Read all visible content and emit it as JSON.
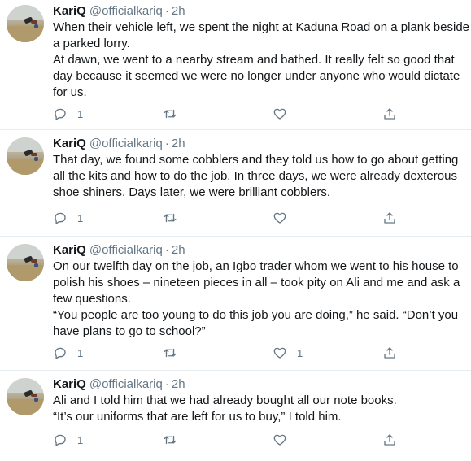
{
  "tweets": [
    {
      "name": "KariQ",
      "handle": "@officialkariq",
      "separator": "·",
      "time": "2h",
      "paragraphs": [
        "When their vehicle left, we spent the night at Kaduna Road on a plank beside a parked lorry.",
        "At dawn, we went to a nearby stream and bathed. It really felt so good that day because it seemed we were no longer under anyone who would dictate for us."
      ],
      "reply_count": "1",
      "retweet_count": "",
      "like_count": ""
    },
    {
      "name": "KariQ",
      "handle": "@officialkariq",
      "separator": "·",
      "time": "2h",
      "paragraphs": [
        "That day, we found some cobblers and they told us how to go about getting all the kits and how to do the job. In three days, we were already dexterous shoe shiners. Days later, we were brilliant cobblers."
      ],
      "reply_count": "1",
      "retweet_count": "",
      "like_count": ""
    },
    {
      "name": "KariQ",
      "handle": "@officialkariq",
      "separator": "·",
      "time": "2h",
      "paragraphs": [
        "On our twelfth day on the job, an Igbo trader whom we went to his house to polish his shoes – nineteen pieces in all – took pity on Ali and me and ask a few questions.",
        "“You people are too young to do this job you are doing,” he said. “Don’t you have plans to go to school?”"
      ],
      "reply_count": "1",
      "retweet_count": "",
      "like_count": "1"
    },
    {
      "name": "KariQ",
      "handle": "@officialkariq",
      "separator": "·",
      "time": "2h",
      "paragraphs": [
        "Ali and I told him that we had already bought all our note books.",
        "“It’s our uniforms that are left for us to buy,” I told him."
      ],
      "reply_count": "1",
      "retweet_count": "",
      "like_count": ""
    }
  ],
  "icons": {
    "reply": "reply-icon",
    "retweet": "retweet-icon",
    "like": "heart-icon",
    "share": "share-icon"
  },
  "colors": {
    "text": "#14171a",
    "muted": "#657786",
    "divider": "#e6ecf0"
  }
}
